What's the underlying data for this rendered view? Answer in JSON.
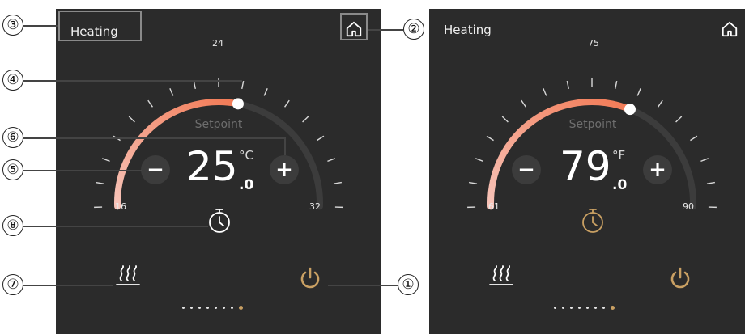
{
  "left_panel": {
    "mode_label": "Heating",
    "setpoint_label": "Setpoint",
    "temperature_value": "25",
    "temperature_decimal": ".0",
    "temperature_unit": "°C",
    "scale_min": "16",
    "scale_max": "32",
    "scale_mid": "24",
    "minus_label": "−",
    "plus_label": "+",
    "arc_fill_fraction": 0.56
  },
  "right_panel": {
    "mode_label": "Heating",
    "setpoint_label": "Setpoint",
    "temperature_value": "79",
    "temperature_decimal": ".0",
    "temperature_unit": "°F",
    "scale_min": "61",
    "scale_max": "90",
    "scale_mid": "75",
    "minus_label": "−",
    "plus_label": "+",
    "arc_fill_fraction": 0.62
  },
  "page_indicator": {
    "count": 8,
    "active_index": 7
  },
  "callouts": [
    "③",
    "②",
    "④",
    "⑥",
    "⑤",
    "⑧",
    "⑦",
    "①"
  ],
  "colors": {
    "panel_bg": "#2b2b2b",
    "arc_gradient_start": "#f7c3b8",
    "arc_gradient_end": "#f27a55",
    "track": "#3c3c3c",
    "accent_gold": "#c9a063",
    "text": "#ffffff"
  },
  "icons": {
    "home": "home-icon",
    "timer": "timer-icon",
    "heating_mode": "heating-mode-icon",
    "power": "power-icon"
  }
}
